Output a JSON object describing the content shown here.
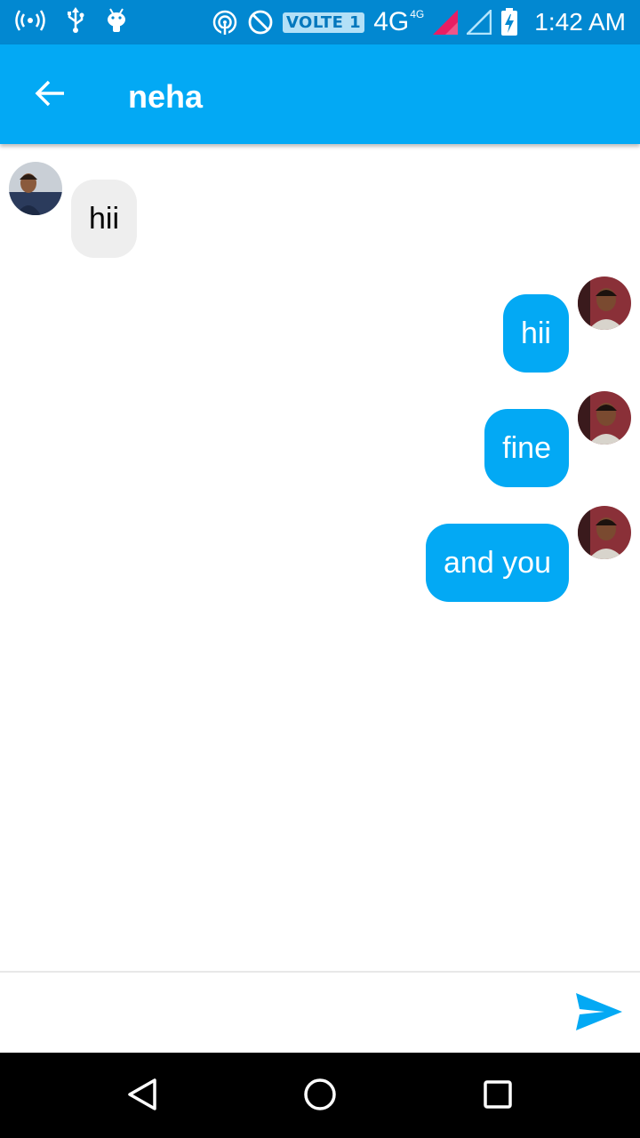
{
  "status_bar": {
    "icons": [
      "hotspot-icon",
      "usb-icon",
      "android-debug-icon",
      "nfc-icon",
      "do-not-disturb-icon"
    ],
    "volte_label": "VOLTE 1",
    "network_label": "4G",
    "network_sup": "4G",
    "time": "1:42 AM"
  },
  "app_bar": {
    "back_icon": "arrow-left-icon",
    "title": "neha",
    "color": "#03a9f4"
  },
  "messages": [
    {
      "direction": "incoming",
      "text": "hii"
    },
    {
      "direction": "outgoing",
      "text": "hii"
    },
    {
      "direction": "outgoing",
      "text": "fine"
    },
    {
      "direction": "outgoing",
      "text": "and you"
    }
  ],
  "composer": {
    "input_value": "",
    "input_placeholder": "",
    "send_icon": "send-icon"
  },
  "nav_bar": {
    "icons": [
      "back-triangle-icon",
      "home-circle-icon",
      "recents-square-icon"
    ]
  },
  "colors": {
    "status_bar": "#0288d1",
    "accent": "#03a9f4",
    "incoming_bubble": "#eeeeee"
  }
}
